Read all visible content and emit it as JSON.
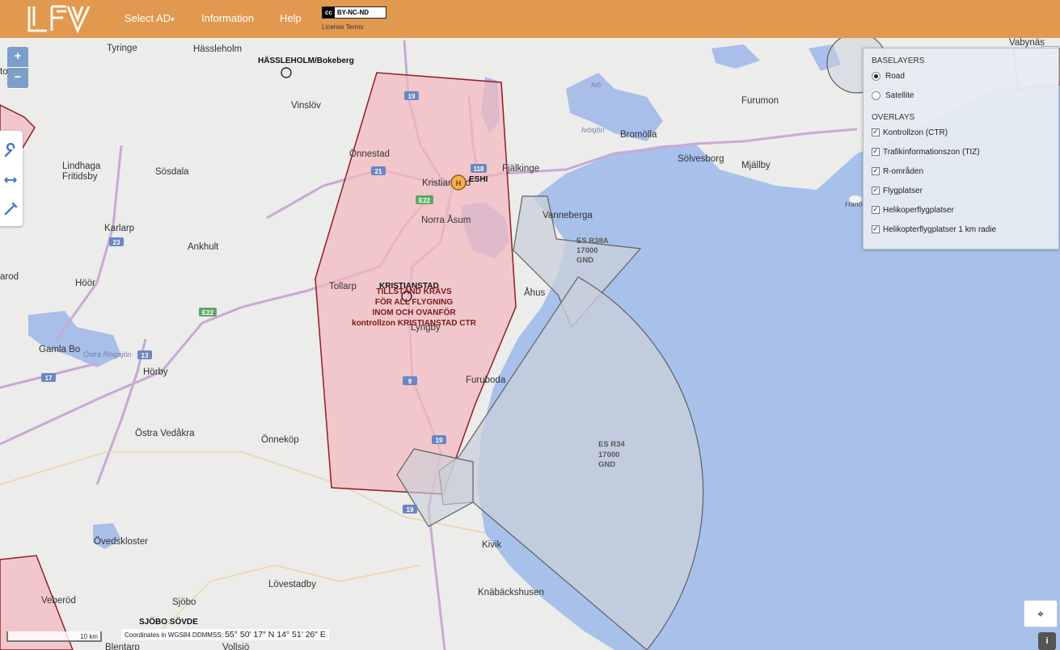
{
  "header": {
    "brand": "LFV",
    "nav": [
      {
        "label": "Select AD",
        "caret": "▾"
      },
      {
        "label": "Information"
      },
      {
        "label": "Help"
      }
    ],
    "license": {
      "badge_cc": "cc",
      "badge_text": "BY-NC-ND",
      "caption": "License Terms"
    }
  },
  "map": {
    "zoom": {
      "in_label": "+",
      "out_label": "−"
    },
    "tools": [
      "wrench-icon",
      "measure-arrows-icon",
      "pencil-icon"
    ],
    "colors": {
      "land": "#ececea",
      "sea": "#a7c1eb",
      "lake": "#a9bee9",
      "ctr_fill": "#f3b9bf",
      "ctr_stroke": "#8d1f24",
      "restricted_fill": "#c9cfd9",
      "restricted_stroke": "#606060",
      "road": "#c9a9d4",
      "header": "#e0994f"
    },
    "places": [
      {
        "name": "Tyringe"
      },
      {
        "name": "Hässleholm"
      },
      {
        "name": "Vinslöv"
      },
      {
        "name": "Önnestad"
      },
      {
        "name": "Lindhaga"
      },
      {
        "name": "Fritidsby"
      },
      {
        "name": "Sösdala"
      },
      {
        "name": "Kristianstad"
      },
      {
        "name": "Fjälkinge"
      },
      {
        "name": "Bromölla"
      },
      {
        "name": "Sölvesborg"
      },
      {
        "name": "Mjällby"
      },
      {
        "name": "Furumon"
      },
      {
        "name": "Vanneberga"
      },
      {
        "name": "Norra Åsum"
      },
      {
        "name": "Karlarp"
      },
      {
        "name": "Ankhult"
      },
      {
        "name": "Höör"
      },
      {
        "name": "Tollarp"
      },
      {
        "name": "Åhus"
      },
      {
        "name": "Lyngby"
      },
      {
        "name": "Gamla Bo"
      },
      {
        "name": "Hörby"
      },
      {
        "name": "Furuboda"
      },
      {
        "name": "Östra Vedåkra"
      },
      {
        "name": "Önneköp"
      },
      {
        "name": "Övedskloster"
      },
      {
        "name": "Kivik"
      },
      {
        "name": "Lövestadby"
      },
      {
        "name": "Veberöd"
      },
      {
        "name": "Sjöbo"
      },
      {
        "name": "Knäbäckshusen"
      },
      {
        "name": "Vabynäs"
      },
      {
        "name": "Ivö"
      },
      {
        "name": "Ivösjön"
      },
      {
        "name": "Östra Ringsjön"
      },
      {
        "name": "Hanö"
      },
      {
        "name": "Blentarp"
      },
      {
        "name": "Vollsjö"
      },
      {
        "name": "arod"
      },
      {
        "name": "torp"
      }
    ],
    "roads": [
      "19",
      "21",
      "118",
      "E22",
      "23",
      "E22",
      "13",
      "17",
      "9",
      "19",
      "19"
    ],
    "aerodromes": [
      {
        "name": "HÄSSLEHOLM/Bokeberg"
      },
      {
        "name": "ESHI"
      },
      {
        "name": "KRISTIANSTAD"
      },
      {
        "name": "SJÖBO SÖVDE"
      }
    ],
    "ctr_notice": [
      "TILLSTÅND KRÄVS",
      "FÖR ALL FLYGNING",
      "INOM OCH OVANFÖR",
      "kontrollzon KRISTIANSTAD CTR"
    ],
    "restricted": [
      {
        "name": "ES R38A",
        "upper": "17000",
        "lower": "GND"
      },
      {
        "name": "ES R34",
        "upper": "17000",
        "lower": "GND"
      }
    ],
    "scale": "10 km",
    "coordinates": {
      "prefix": "Coordinates in WGS84 DDMMSS:",
      "value": "55° 50′ 17″ N 14° 51′ 26″ E"
    }
  },
  "layers": {
    "baselayers_title": "BASELAYERS",
    "baselayers": [
      {
        "label": "Road",
        "selected": true
      },
      {
        "label": "Satellite",
        "selected": false
      }
    ],
    "overlays_title": "OVERLAYS",
    "overlays": [
      {
        "label": "Kontrollzon (CTR)",
        "checked": true
      },
      {
        "label": "Trafikinformationszon (TIZ)",
        "checked": true
      },
      {
        "label": "R-områden",
        "checked": true
      },
      {
        "label": "Flygplatser",
        "checked": true
      },
      {
        "label": "Helikoperflygplatser",
        "checked": true
      },
      {
        "label": "Helikopterflygplatser 1 km radie",
        "checked": true
      }
    ],
    "minimize": "−"
  },
  "controls": {
    "locate": "⌖",
    "info": "i"
  }
}
